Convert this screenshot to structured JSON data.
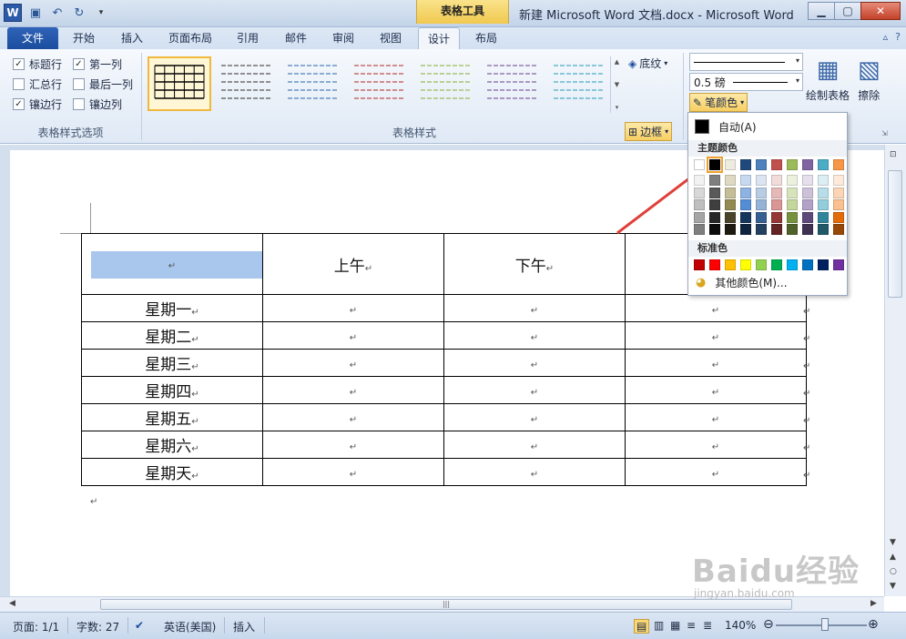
{
  "app": {
    "window_title": "新建 Microsoft Word 文档.docx - Microsoft Word",
    "context_tab_group": "表格工具",
    "logo_letter": "W"
  },
  "tabs": [
    {
      "label": "文件"
    },
    {
      "label": "开始"
    },
    {
      "label": "插入"
    },
    {
      "label": "页面布局"
    },
    {
      "label": "引用"
    },
    {
      "label": "邮件"
    },
    {
      "label": "审阅"
    },
    {
      "label": "视图"
    },
    {
      "label": "设计"
    },
    {
      "label": "布局"
    }
  ],
  "ribbon": {
    "options_group": {
      "label": "表格样式选项",
      "checks": [
        {
          "label": "标题行",
          "checked": true
        },
        {
          "label": "第一列",
          "checked": true
        },
        {
          "label": "汇总行",
          "checked": false
        },
        {
          "label": "最后一列",
          "checked": false
        },
        {
          "label": "镶边行",
          "checked": true
        },
        {
          "label": "镶边列",
          "checked": false
        }
      ]
    },
    "styles_group": {
      "label": "表格样式",
      "shading_label": "底纹",
      "borders_label": "边框",
      "thumb_colors": [
        "#000000",
        "#555555",
        "#4f81bd",
        "#c0504d",
        "#9bbb59",
        "#8064a2",
        "#4bacc6"
      ]
    },
    "draw_group": {
      "line_weight": "0.5 磅",
      "pen_color_label": "笔颜色",
      "draw_table_label": "绘制表格",
      "eraser_label": "擦除"
    }
  },
  "color_menu": {
    "auto_label": "自动(A)",
    "theme_header": "主题颜色",
    "standard_header": "标准色",
    "more_colors_label": "其他颜色(M)...",
    "theme_top_row": [
      "#ffffff",
      "#000000",
      "#eeece1",
      "#1f497d",
      "#4f81bd",
      "#c0504d",
      "#9bbb59",
      "#8064a2",
      "#4bacc6",
      "#f79646"
    ],
    "theme_shades": [
      [
        "#f2f2f2",
        "#7f7f7f",
        "#ddd9c3",
        "#c6d9f0",
        "#dbe5f1",
        "#f2dcdb",
        "#ebf1dd",
        "#e5e0ec",
        "#dbeef3",
        "#fdeada"
      ],
      [
        "#d8d8d8",
        "#595959",
        "#c4bd97",
        "#8db3e2",
        "#b8cce4",
        "#e5b9b7",
        "#d7e3bc",
        "#ccc1d9",
        "#b7dde8",
        "#fbd5b5"
      ],
      [
        "#bfbfbf",
        "#3f3f3f",
        "#938953",
        "#548dd4",
        "#95b3d7",
        "#d99694",
        "#c3d69b",
        "#b2a2c7",
        "#92cddc",
        "#fac08f"
      ],
      [
        "#a5a5a5",
        "#262626",
        "#494429",
        "#17365d",
        "#366092",
        "#953734",
        "#76923c",
        "#5f497a",
        "#31859b",
        "#e36c09"
      ],
      [
        "#7f7f7f",
        "#0c0c0c",
        "#1d1b10",
        "#0f243e",
        "#244061",
        "#632423",
        "#4f6128",
        "#3f3151",
        "#205867",
        "#974806"
      ]
    ],
    "standard_colors": [
      "#c00000",
      "#ff0000",
      "#ffc000",
      "#ffff00",
      "#92d050",
      "#00b050",
      "#00b0f0",
      "#0070c0",
      "#002060",
      "#7030a0"
    ]
  },
  "document": {
    "paragraph_mark": "↵",
    "header_row": [
      "",
      "上午",
      "下午",
      ""
    ],
    "rows": [
      "星期一",
      "星期二",
      "星期三",
      "星期四",
      "星期五",
      "星期六",
      "星期天"
    ]
  },
  "status": {
    "page": "页面: 1/1",
    "words": "字数: 27",
    "language": "英语(美国)",
    "mode": "插入",
    "zoom": "140%"
  },
  "watermark": {
    "brand": "Baidu经验",
    "url": "jingyan.baidu.com"
  }
}
